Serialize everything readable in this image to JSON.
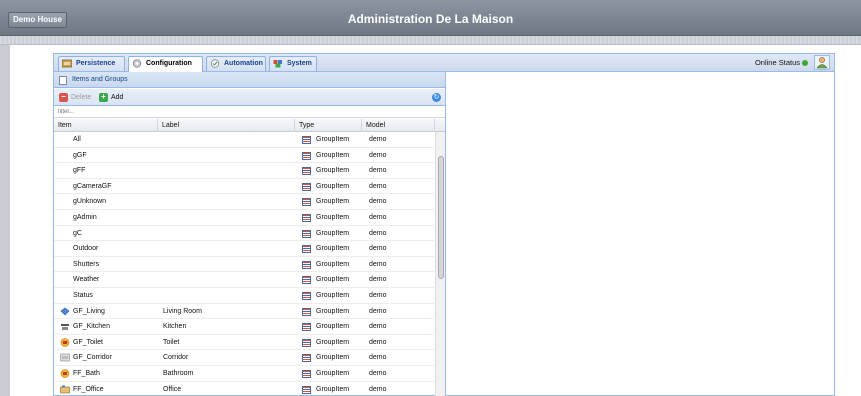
{
  "header": {
    "home_button": "Demo House",
    "title": "Administration De La Maison"
  },
  "tabs": [
    {
      "label": "Persistence",
      "icon": "persistence-icon"
    },
    {
      "label": "Configuration",
      "icon": "configuration-icon",
      "active": true
    },
    {
      "label": "Automation",
      "icon": "automation-icon"
    },
    {
      "label": "System",
      "icon": "system-icon"
    }
  ],
  "status": {
    "label": "Online Status",
    "color": "#3aaa35"
  },
  "pane": {
    "title": "Items and Groups",
    "toolbar": {
      "delete_label": "Delete",
      "add_label": "Add"
    },
    "filter_placeholder": "filter..."
  },
  "grid": {
    "columns": [
      "Item",
      "Label",
      "Type",
      "Model"
    ],
    "rows": [
      {
        "item": "All",
        "label": "",
        "type": "GroupItem",
        "model": "demo",
        "icon": ""
      },
      {
        "item": "gGF",
        "label": "",
        "type": "GroupItem",
        "model": "demo",
        "icon": ""
      },
      {
        "item": "gFF",
        "label": "",
        "type": "GroupItem",
        "model": "demo",
        "icon": ""
      },
      {
        "item": "gCameraGF",
        "label": "",
        "type": "GroupItem",
        "model": "demo",
        "icon": ""
      },
      {
        "item": "gUnknown",
        "label": "",
        "type": "GroupItem",
        "model": "demo",
        "icon": ""
      },
      {
        "item": "gAdmin",
        "label": "",
        "type": "GroupItem",
        "model": "demo",
        "icon": ""
      },
      {
        "item": "gC",
        "label": "",
        "type": "GroupItem",
        "model": "demo",
        "icon": ""
      },
      {
        "item": "Outdoor",
        "label": "",
        "type": "GroupItem",
        "model": "demo",
        "icon": ""
      },
      {
        "item": "Shutters",
        "label": "",
        "type": "GroupItem",
        "model": "demo",
        "icon": ""
      },
      {
        "item": "Weather",
        "label": "",
        "type": "GroupItem",
        "model": "demo",
        "icon": ""
      },
      {
        "item": "Status",
        "label": "",
        "type": "GroupItem",
        "model": "demo",
        "icon": ""
      },
      {
        "item": "GF_Living",
        "label": "Living Room",
        "type": "GroupItem",
        "model": "demo",
        "icon": "sofa-icon"
      },
      {
        "item": "GF_Kitchen",
        "label": "Kitchen",
        "type": "GroupItem",
        "model": "demo",
        "icon": "kitchen-icon"
      },
      {
        "item": "GF_Toilet",
        "label": "Toilet",
        "type": "GroupItem",
        "model": "demo",
        "icon": "toilet-icon"
      },
      {
        "item": "GF_Corridor",
        "label": "Corridor",
        "type": "GroupItem",
        "model": "demo",
        "icon": "corridor-icon"
      },
      {
        "item": "FF_Bath",
        "label": "Bathroom",
        "type": "GroupItem",
        "model": "demo",
        "icon": "bath-icon"
      },
      {
        "item": "FF_Office",
        "label": "Office",
        "type": "GroupItem",
        "model": "demo",
        "icon": "office-icon"
      }
    ]
  }
}
